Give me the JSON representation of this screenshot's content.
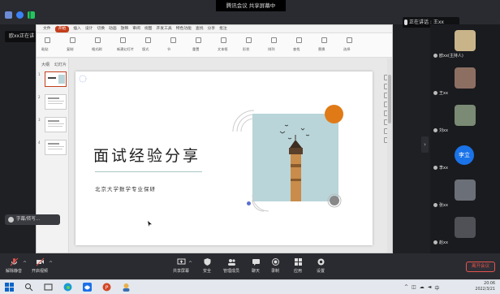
{
  "meeting": {
    "title": "腾讯会议 共享屏幕中",
    "speaker_tag": "欧xx正在讲",
    "speaking_label": "正在讲话 : 王xx"
  },
  "ppt": {
    "tabs": [
      "文件",
      "开始",
      "插入",
      "设计",
      "切换",
      "动画",
      "放映",
      "审阅",
      "视图",
      "开发工具",
      "特色功能",
      "查找",
      "分享",
      "批注"
    ],
    "active_tab": "开始",
    "ribbon_labels": [
      "粘贴",
      "复制",
      "格式刷",
      "新建幻灯片",
      "版式",
      "节",
      "重置",
      "文本框",
      "形状",
      "排列",
      "查找",
      "替换",
      "选择"
    ],
    "thumb_tabs": [
      "大纲",
      "幻灯片"
    ],
    "thumbnail_numbers": [
      "1",
      "2",
      "3",
      "4"
    ],
    "slide": {
      "title": "面试经验分享",
      "subtitle": "北京大学数学专业保研"
    }
  },
  "participants": [
    {
      "name": "欧xx(主持人)",
      "type": "photo",
      "color": "#c9b48a"
    },
    {
      "name": "王xx",
      "type": "photo",
      "color": "#8d6f62"
    },
    {
      "name": "刘xx",
      "type": "photo",
      "color": "#7a8a74"
    },
    {
      "name": "李xx",
      "type": "avatar",
      "initials": "李立",
      "color": "#1a73e8"
    },
    {
      "name": "张xx",
      "type": "photo",
      "color": "#6b6f77"
    },
    {
      "name": "赵xx",
      "type": "photo",
      "color": "#4f5157"
    }
  ],
  "captions_label": "字幕/转写...",
  "meeting_bar": {
    "items": [
      {
        "key": "mute",
        "label": "解除静音",
        "icon": "microphone-icon"
      },
      {
        "key": "video",
        "label": "开启视频",
        "icon": "camera-icon"
      },
      {
        "key": "share",
        "label": "共享屏幕",
        "icon": "share-screen-icon"
      },
      {
        "key": "security",
        "label": "安全",
        "icon": "shield-icon"
      },
      {
        "key": "members",
        "label": "管理成员",
        "icon": "members-icon"
      },
      {
        "key": "chat",
        "label": "聊天",
        "icon": "chat-icon"
      },
      {
        "key": "record",
        "label": "录制",
        "icon": "record-icon"
      },
      {
        "key": "apps",
        "label": "应用",
        "icon": "apps-icon"
      },
      {
        "key": "settings",
        "label": "设置",
        "icon": "gear-icon"
      }
    ],
    "leave_label": "离开会议"
  },
  "taskbar": {
    "time": "20:06",
    "date": "2022/3/21",
    "ime": "中"
  }
}
